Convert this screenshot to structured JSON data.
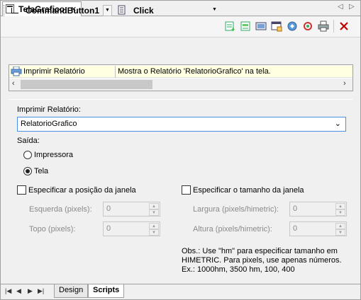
{
  "tab": {
    "title": "TelaGrafico",
    "close": "×"
  },
  "tab_nav": {
    "left": "◁",
    "right": "▷"
  },
  "toolbar": {
    "object_name": "CommandButton1",
    "event_name": "Click"
  },
  "events": {
    "row": {
      "name": "Imprimir Relatório",
      "description": "Mostra o Relatório 'RelatorioGrafico' na tela."
    }
  },
  "form": {
    "report_label": "Imprimir Relatório:",
    "report_value": "RelatorioGrafico",
    "output_label": "Saída:",
    "printer_label": "Impressora",
    "screen_label": "Tela",
    "output_selected": "Tela",
    "position_check_label": "Especificar a posição da janela",
    "left_label": "Esquerda (pixels):",
    "left_value": "0",
    "top_label": "Topo (pixels):",
    "top_value": "0",
    "size_check_label": "Especificar o tamanho da janela",
    "width_label": "Largura (pixels/himetric):",
    "width_value": "0",
    "height_label": "Altura (pixels/himetric):",
    "height_value": "0",
    "note_line1": "Obs.: Use \"hm\" para especificar tamanho em",
    "note_line2": "HIMETRIC. Para pixels, use apenas números.",
    "note_line3": "Ex.: 1000hm, 3500 hm, 100, 400"
  },
  "bottom_tabs": {
    "design": "Design",
    "scripts": "Scripts",
    "active": "Scripts"
  },
  "colors": {
    "accent": "#4a90e2",
    "highlight_row": "#ffffe1",
    "delete": "#c00000"
  }
}
